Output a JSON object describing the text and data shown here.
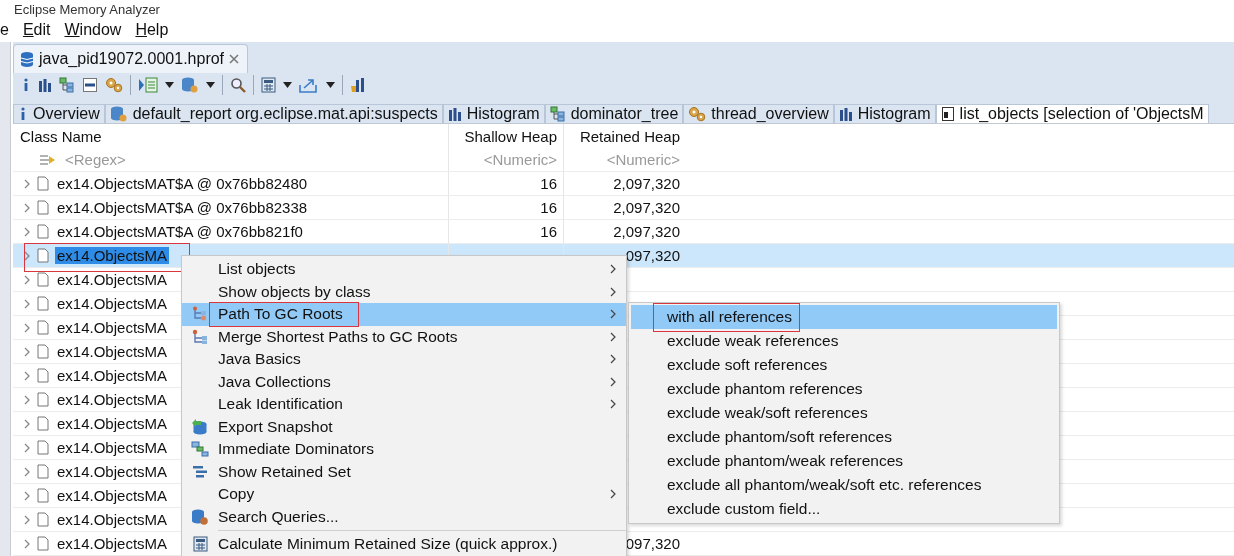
{
  "window": {
    "title": "Eclipse Memory Analyzer"
  },
  "menu_bar": [
    {
      "label": "e",
      "mnemonic": false
    },
    {
      "label": "Edit",
      "mnemonic": true
    },
    {
      "label": "Window",
      "mnemonic": true
    },
    {
      "label": "Help",
      "mnemonic": true
    }
  ],
  "editor_tab": {
    "label": "java_pid19072.0001.hprof",
    "closable": true
  },
  "tabs": [
    {
      "label": "Overview",
      "kind": "overview",
      "selected": false
    },
    {
      "label": "default_report  org.eclipse.mat.api:suspects",
      "kind": "report",
      "selected": false
    },
    {
      "label": "Histogram",
      "kind": "histogram",
      "selected": false
    },
    {
      "label": "dominator_tree",
      "kind": "tree",
      "selected": false
    },
    {
      "label": "thread_overview",
      "kind": "threads",
      "selected": false
    },
    {
      "label": "Histogram",
      "kind": "histogram",
      "selected": false
    },
    {
      "label": "list_objects  [selection of 'ObjectsM",
      "kind": "list",
      "selected": true
    }
  ],
  "table": {
    "columns": [
      "Class Name",
      "Shallow Heap",
      "Retained Heap"
    ],
    "filters": [
      "<Regex>",
      "<Numeric>",
      "<Numeric>"
    ],
    "rows": [
      {
        "name": "ex14.ObjectsMAT$A @ 0x76bb82480",
        "shallow": "16",
        "retained": "2,097,320",
        "selected": false,
        "outlined": false
      },
      {
        "name": "ex14.ObjectsMAT$A @ 0x76bb82338",
        "shallow": "16",
        "retained": "2,097,320",
        "selected": false,
        "outlined": false
      },
      {
        "name": "ex14.ObjectsMAT$A @ 0x76bb821f0",
        "shallow": "16",
        "retained": "2,097,320",
        "selected": false,
        "outlined": false
      },
      {
        "name": "ex14.ObjectsMA",
        "retained": "097,320",
        "selected": true,
        "outlined": true
      },
      {
        "name": "ex14.ObjectsMA",
        "selected": false,
        "outlined": false
      },
      {
        "name": "ex14.ObjectsMA",
        "selected": false,
        "outlined": false
      },
      {
        "name": "ex14.ObjectsMA",
        "selected": false,
        "outlined": false
      },
      {
        "name": "ex14.ObjectsMA",
        "selected": false,
        "outlined": false
      },
      {
        "name": "ex14.ObjectsMA",
        "selected": false,
        "outlined": false
      },
      {
        "name": "ex14.ObjectsMA",
        "selected": false,
        "outlined": false
      },
      {
        "name": "ex14.ObjectsMA",
        "selected": false,
        "outlined": false
      },
      {
        "name": "ex14.ObjectsMA",
        "selected": false,
        "outlined": false
      },
      {
        "name": "ex14.ObjectsMA",
        "selected": false,
        "outlined": false
      },
      {
        "name": "ex14.ObjectsMA",
        "selected": false,
        "outlined": false
      },
      {
        "name": "ex14.ObjectsMA",
        "selected": false,
        "outlined": false
      },
      {
        "name": "ex14.ObjectsMA",
        "retained": "097,320",
        "selected": false,
        "outlined": false
      }
    ]
  },
  "context_menu": {
    "items": [
      {
        "kind": "plain",
        "label": "List objects",
        "has_submenu": true,
        "selected": false,
        "outlined": false
      },
      {
        "kind": "plain",
        "label": "Show objects by class",
        "has_submenu": true,
        "selected": false,
        "outlined": false
      },
      {
        "kind": "path",
        "label": "Path To GC Roots",
        "has_submenu": true,
        "selected": true,
        "outlined": true
      },
      {
        "kind": "merge",
        "label": "Merge Shortest Paths to GC Roots",
        "has_submenu": true,
        "selected": false,
        "outlined": false
      },
      {
        "kind": "plain",
        "label": "Java Basics",
        "has_submenu": true,
        "selected": false,
        "outlined": false
      },
      {
        "kind": "plain",
        "label": "Java Collections",
        "has_submenu": true,
        "selected": false,
        "outlined": false
      },
      {
        "kind": "plain",
        "label": "Leak Identification",
        "has_submenu": true,
        "selected": false,
        "outlined": false
      },
      {
        "kind": "export",
        "label": "Export Snapshot",
        "has_submenu": false,
        "selected": false,
        "outlined": false
      },
      {
        "kind": "dominators",
        "label": "Immediate Dominators",
        "has_submenu": false,
        "selected": false,
        "outlined": false
      },
      {
        "kind": "retained",
        "label": "Show Retained Set",
        "has_submenu": false,
        "selected": false,
        "outlined": false
      },
      {
        "kind": "plain",
        "label": "Copy",
        "has_submenu": true,
        "selected": false,
        "outlined": false
      },
      {
        "kind": "search",
        "label": "Search Queries...",
        "has_submenu": false,
        "selected": false,
        "outlined": false
      },
      {
        "kind": "separator"
      },
      {
        "kind": "calc",
        "label": "Calculate Minimum Retained Size (quick approx.)",
        "has_submenu": false,
        "selected": false,
        "outlined": false
      }
    ]
  },
  "submenu": {
    "items": [
      {
        "label": "with all references",
        "selected": true,
        "outlined": true
      },
      {
        "label": "exclude weak references",
        "selected": false,
        "outlined": false
      },
      {
        "label": "exclude soft references",
        "selected": false,
        "outlined": false
      },
      {
        "label": "exclude phantom references",
        "selected": false,
        "outlined": false
      },
      {
        "label": "exclude weak/soft references",
        "selected": false,
        "outlined": false
      },
      {
        "label": "exclude phantom/soft references",
        "selected": false,
        "outlined": false
      },
      {
        "label": "exclude phantom/weak references",
        "selected": false,
        "outlined": false
      },
      {
        "label": "exclude all phantom/weak/soft etc. references",
        "selected": false,
        "outlined": false
      },
      {
        "label": "exclude custom field...",
        "selected": false,
        "outlined": false
      }
    ]
  }
}
